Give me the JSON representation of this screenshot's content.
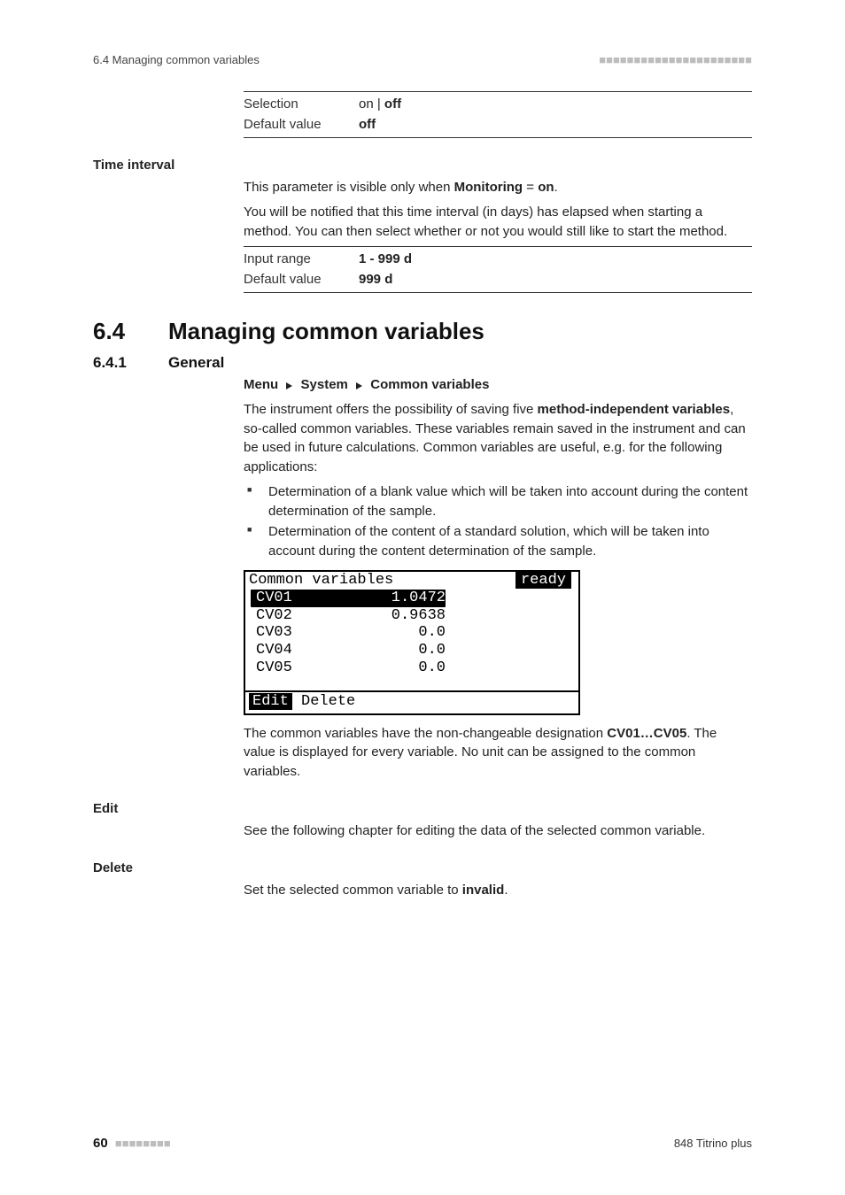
{
  "runhead": {
    "left": "6.4 Managing common variables",
    "dots": "■■■■■■■■■■■■■■■■■■■■■■"
  },
  "table1": {
    "selection_label": "Selection",
    "selection_value_pre": "on",
    "selection_sep": " | ",
    "selection_value_bold": "off",
    "default_label": "Default value",
    "default_value": "off"
  },
  "time_interval": {
    "heading": "Time interval",
    "p1_pre": "This parameter is visible only when ",
    "p1_b1": "Monitoring",
    "p1_eq": " = ",
    "p1_b2": "on",
    "p1_post": ".",
    "p2": "You will be notified that this time interval (in days) has elapsed when starting a method. You can then select whether or not you would still like to start the method."
  },
  "table2": {
    "input_label": "Input range",
    "input_value": "1 - 999 d",
    "default_label": "Default value",
    "default_value": "999 d"
  },
  "h1": {
    "num": "6.4",
    "txt": "Managing common variables"
  },
  "h2": {
    "num": "6.4.1",
    "txt": "General"
  },
  "breadcrumb": {
    "a": "Menu",
    "b": "System",
    "c": "Common variables"
  },
  "para1": {
    "pre": "The instrument offers the possibility of saving five ",
    "b": "method-independent variables",
    "post": ", so-called common variables. These variables remain saved in the instrument and can be used in future calculations. Common variables are useful, e.g. for the following applications:"
  },
  "bullets": [
    "Determination of a blank value which will be taken into account during the content determination of the sample.",
    "Determination of the content of a standard solution, which will be taken into account during the content determination of the sample."
  ],
  "lcd": {
    "title": "Common variables",
    "status": "ready",
    "rows": [
      {
        "name": "CV01",
        "val": "1.0472",
        "selected": true
      },
      {
        "name": "CV02",
        "val": "0.9638",
        "selected": false
      },
      {
        "name": "CV03",
        "val": "0.0",
        "selected": false
      },
      {
        "name": "CV04",
        "val": "0.0",
        "selected": false
      },
      {
        "name": "CV05",
        "val": "0.0",
        "selected": false
      }
    ],
    "foot_sel": "Edit",
    "foot_rest": " Delete"
  },
  "para2": {
    "pre": "The common variables have the non-changeable designation ",
    "b": "CV01…CV05",
    "post": ". The value is displayed for every variable. No unit can be assigned to the common variables."
  },
  "edit": {
    "heading": "Edit",
    "text": "See the following chapter for editing the data of the selected common variable."
  },
  "del": {
    "heading": "Delete",
    "pre": "Set the selected common variable to ",
    "b": "invalid",
    "post": "."
  },
  "footer": {
    "page": "60",
    "dots": "■■■■■■■■",
    "doc": "848 Titrino plus"
  }
}
